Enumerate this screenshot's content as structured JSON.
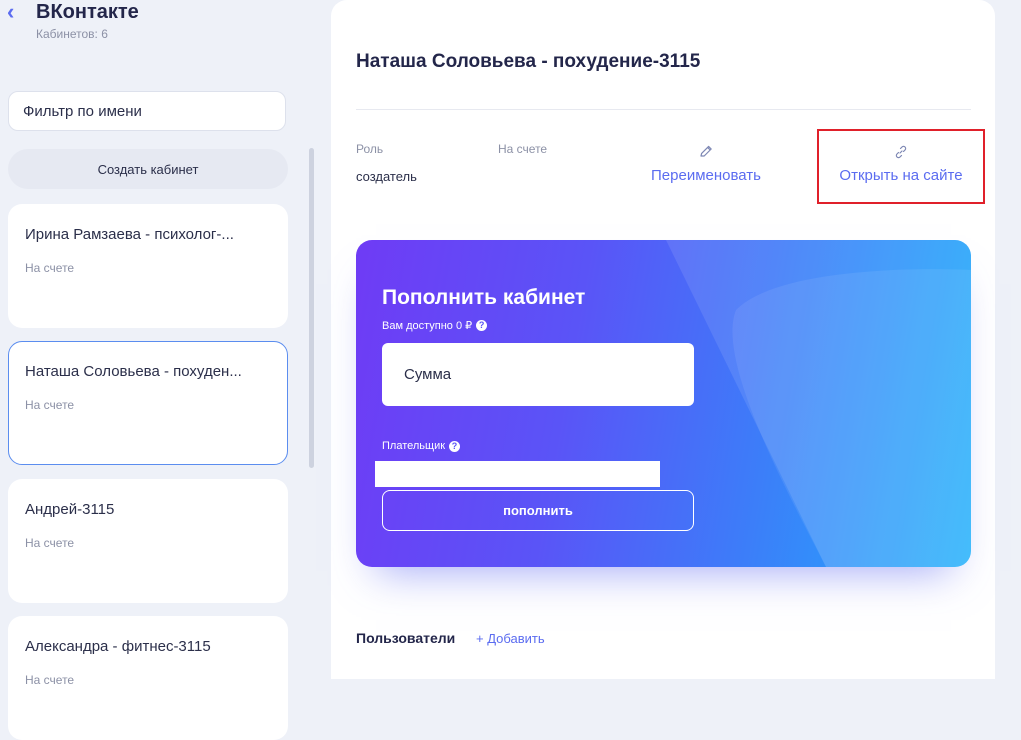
{
  "sidebar": {
    "back_icon": "‹",
    "app_title": "ВКонтакте",
    "cabinets_count": "Кабинетов: 6",
    "filter_placeholder": "Фильтр по имени",
    "create_button": "Создать кабинет",
    "cards": [
      {
        "title": "Ирина Рамзаева - психолог-...",
        "status": "На счете"
      },
      {
        "title": "Наташа Соловьева - похуден...",
        "status": "На счете"
      },
      {
        "title": "Андрей-3115",
        "status": "На счете"
      },
      {
        "title": "Александра - фитнес-3115",
        "status": "На счете"
      }
    ]
  },
  "main": {
    "title": "Наташа Соловьева - похудение-3115",
    "role_label": "Роль",
    "role_value": "создатель",
    "balance_label": "На счете",
    "rename_label": "Переименовать",
    "open_site_label": "Открыть на сайте",
    "topup": {
      "title": "Пополнить кабинет",
      "available": "Вам доступно 0 ₽",
      "amount_placeholder": "Сумма",
      "payer_label": "Плательщик",
      "button": "пополнить"
    },
    "users_title": "Пользователи",
    "add_label": "+ Добавить"
  },
  "colors": {
    "accent": "#5b6cf0",
    "highlight": "#e0202a",
    "gradient_start": "#6f3bf5",
    "gradient_end": "#1fb0fb"
  },
  "icons": [
    "back-chevron-icon",
    "pencil-icon",
    "link-icon",
    "question-icon"
  ]
}
